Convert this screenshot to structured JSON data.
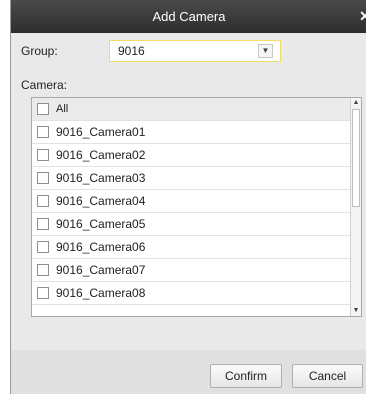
{
  "dialog": {
    "title": "Add Camera",
    "close_glyph": "✕",
    "group_label": "Group:",
    "group_value": "9016",
    "camera_label": "Camera:",
    "select_all_label": "All",
    "cameras": [
      "9016_Camera01",
      "9016_Camera02",
      "9016_Camera03",
      "9016_Camera04",
      "9016_Camera05",
      "9016_Camera06",
      "9016_Camera07",
      "9016_Camera08"
    ],
    "confirm_label": "Confirm",
    "cancel_label": "Cancel"
  },
  "icons": {
    "close": "close-icon",
    "dropdown": "chevron-down-icon",
    "scroll_up": "triangle-up-icon",
    "scroll_down": "triangle-down-icon",
    "checkbox": "checkbox-unchecked-icon"
  },
  "colors": {
    "titlebar": "#333333",
    "dialog_bg": "#e9e9e9",
    "select_border": "#f0dc6b"
  }
}
